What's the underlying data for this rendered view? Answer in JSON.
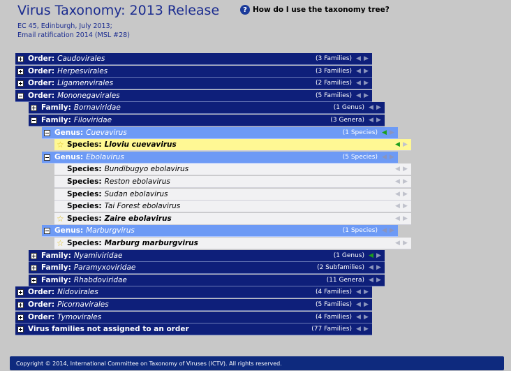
{
  "header": {
    "title": "Virus Taxonomy: 2013 Release",
    "meta_line1": "EC 45, Edinburgh, July 2013;",
    "meta_line2": "Email ratification 2014 (MSL #28)",
    "help_label": "How do I use the taxonomy tree?"
  },
  "tree": [
    {
      "rank": "Order:",
      "name": "Caudovirales",
      "count": "(3 Families)",
      "level": "order",
      "expanded": false,
      "left_active": false
    },
    {
      "rank": "Order:",
      "name": "Herpesvirales",
      "count": "(3 Families)",
      "level": "order",
      "expanded": false,
      "left_active": false
    },
    {
      "rank": "Order:",
      "name": "Ligamenvirales",
      "count": "(2 Families)",
      "level": "order",
      "expanded": false,
      "left_active": false
    },
    {
      "rank": "Order:",
      "name": "Mononegavirales",
      "count": "(5 Families)",
      "level": "order",
      "expanded": true,
      "left_active": false
    },
    {
      "rank": "Family:",
      "name": "Bornaviridae",
      "count": "(1 Genus)",
      "level": "family",
      "expanded": false,
      "left_active": false
    },
    {
      "rank": "Family:",
      "name": "Filoviridae",
      "count": "(3 Genera)",
      "level": "family",
      "expanded": true,
      "left_active": false
    },
    {
      "rank": "Genus:",
      "name": "Cuevavirus",
      "count": "(1 Species)",
      "level": "genus",
      "expanded": true,
      "left_active": true
    },
    {
      "rank": "Species:",
      "name": "Lloviu cuevavirus",
      "count": "",
      "level": "species",
      "selected": true,
      "star": true,
      "bold": true,
      "left_active": true
    },
    {
      "rank": "Genus:",
      "name": "Ebolavirus",
      "count": "(5 Species)",
      "level": "genus",
      "expanded": true,
      "left_active": false
    },
    {
      "rank": "Species:",
      "name": "Bundibugyo ebolavirus",
      "count": "",
      "level": "species",
      "left_active": false
    },
    {
      "rank": "Species:",
      "name": "Reston ebolavirus",
      "count": "",
      "level": "species",
      "left_active": false
    },
    {
      "rank": "Species:",
      "name": "Sudan ebolavirus",
      "count": "",
      "level": "species",
      "left_active": false
    },
    {
      "rank": "Species:",
      "name": "Tai Forest ebolavirus",
      "count": "",
      "level": "species",
      "left_active": false
    },
    {
      "rank": "Species:",
      "name": "Zaire ebolavirus",
      "count": "",
      "level": "species",
      "star": true,
      "bold": true,
      "left_active": false
    },
    {
      "rank": "Genus:",
      "name": "Marburgvirus",
      "count": "(1 Species)",
      "level": "genus",
      "expanded": true,
      "left_active": false
    },
    {
      "rank": "Species:",
      "name": "Marburg marburgvirus",
      "count": "",
      "level": "species",
      "star": true,
      "bold": true,
      "left_active": false
    },
    {
      "rank": "Family:",
      "name": "Nyamiviridae",
      "count": "(1 Genus)",
      "level": "family",
      "expanded": false,
      "left_active": true
    },
    {
      "rank": "Family:",
      "name": "Paramyxoviridae",
      "count": "(2 Subfamilies)",
      "level": "family",
      "expanded": false,
      "left_active": false
    },
    {
      "rank": "Family:",
      "name": "Rhabdoviridae",
      "count": "(11 Genera)",
      "level": "family",
      "expanded": false,
      "left_active": false
    },
    {
      "rank": "Order:",
      "name": "Nidovirales",
      "count": "(4 Families)",
      "level": "order",
      "expanded": false,
      "left_active": false
    },
    {
      "rank": "Order:",
      "name": "Picornavirales",
      "count": "(5 Families)",
      "level": "order",
      "expanded": false,
      "left_active": false
    },
    {
      "rank": "Order:",
      "name": "Tymovirales",
      "count": "(4 Families)",
      "level": "order",
      "expanded": false,
      "left_active": false
    },
    {
      "rank": "Virus families not assigned to an order",
      "name": "",
      "count": "(77 Families)",
      "level": "order",
      "expanded": false,
      "left_active": false
    }
  ],
  "footer": {
    "text": "Copyright © 2014, International Committee on Taxonomy of Viruses (ICTV).   All rights reserved."
  },
  "colors": {
    "order_bg": "#0e1f7a",
    "genus_bg": "#6d9af5",
    "species_bg": "#f1f1f3",
    "selected_bg": "#fff894",
    "active_arrow": "#1c9e1c"
  }
}
